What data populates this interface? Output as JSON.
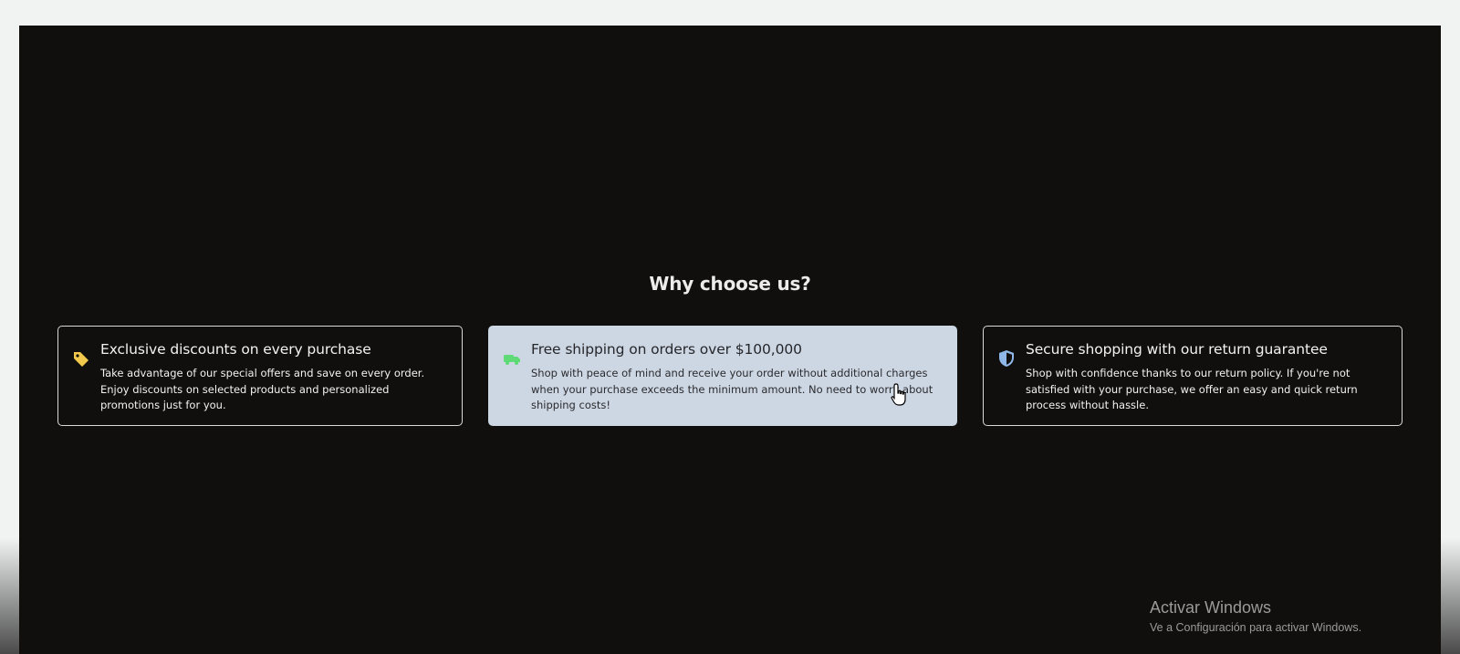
{
  "section": {
    "title": "Why choose us?"
  },
  "cards": [
    {
      "icon": "tag-icon",
      "icon_color": "#f2c94c",
      "title": "Exclusive discounts on every purchase",
      "description": "Take advantage of our special offers and save on every order. Enjoy discounts on selected products and personalized promotions just for you."
    },
    {
      "icon": "truck-icon",
      "icon_color": "#4cd964",
      "title": "Free shipping on orders over $100,000",
      "description": "Shop with peace of mind and receive your order without additional charges when your purchase exceeds the minimum amount. No need to worry about shipping costs!",
      "state": "hovered"
    },
    {
      "icon": "shield-icon",
      "icon_color": "#8fb8e8",
      "title": "Secure shopping with our return guarantee",
      "description": "Shop with confidence thanks to our return policy. If you're not satisfied with your purchase, we offer an easy and quick return process without hassle."
    }
  ],
  "watermark": {
    "title": "Activar Windows",
    "subtitle": "Ve a Configuración para activar Windows."
  },
  "colors": {
    "background": "#100f0d",
    "card_border": "#d9d9d9",
    "card_active_bg": "#cdd6e3",
    "outer_frame": "#f1f2f2"
  }
}
